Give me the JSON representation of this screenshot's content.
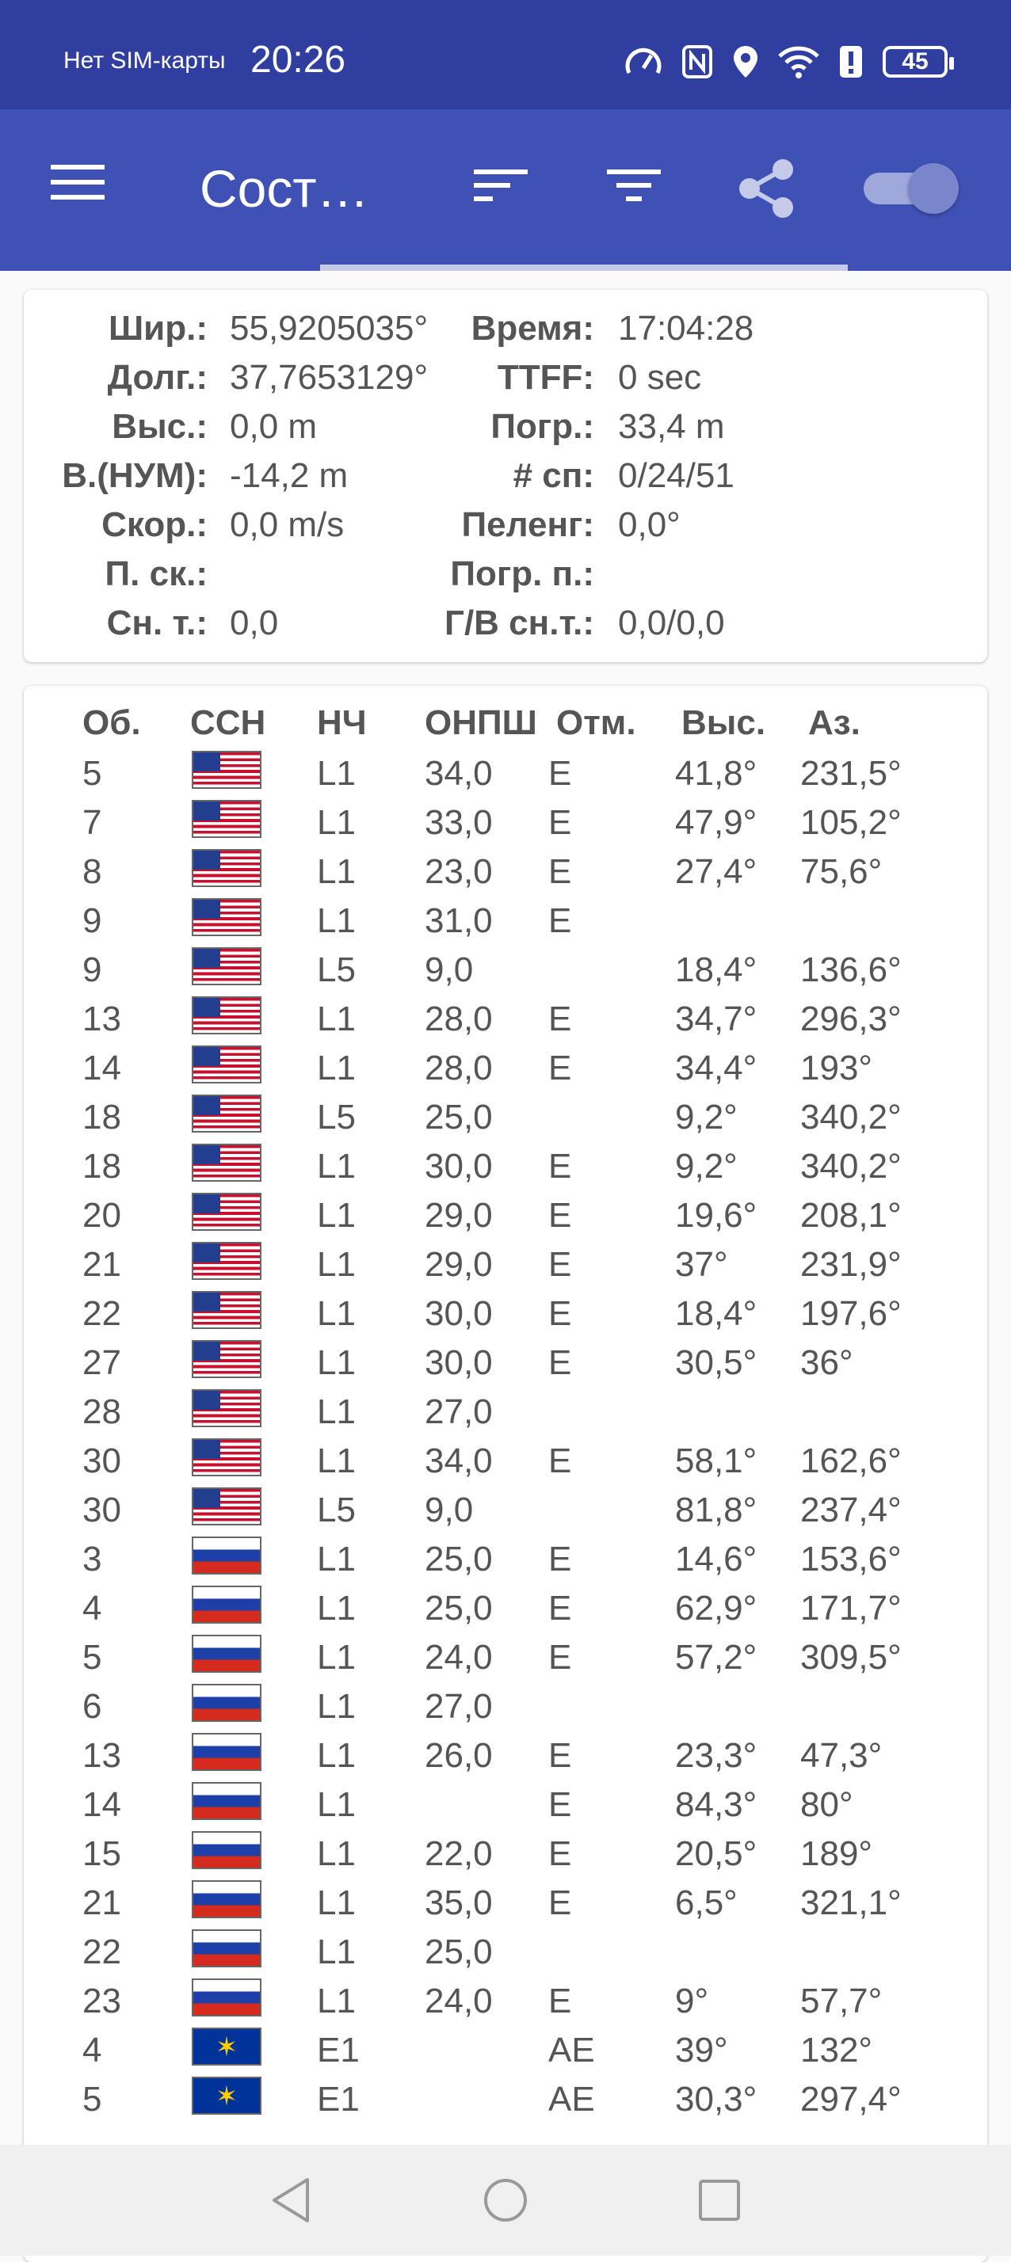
{
  "status_bar": {
    "carrier": "Нет SIM-карты",
    "time": "20:26",
    "battery": "45"
  },
  "app_bar": {
    "title": "Сост…",
    "colors": {
      "primary": "#3f51b5",
      "status": "#303f9f"
    }
  },
  "location": {
    "left": [
      {
        "label": "Шир.:",
        "value": "55,9205035°"
      },
      {
        "label": "Долг.:",
        "value": "37,7653129°"
      },
      {
        "label": "Выс.:",
        "value": "0,0 m"
      },
      {
        "label": "В.(НУМ):",
        "value": "-14,2 m"
      },
      {
        "label": "Скор.:",
        "value": "0,0 m/s"
      },
      {
        "label": "П. ск.:",
        "value": ""
      },
      {
        "label": "Сн. т.:",
        "value": "0,0"
      }
    ],
    "right": [
      {
        "label": "Время:",
        "value": "17:04:28"
      },
      {
        "label": "TTFF:",
        "value": "0 sec"
      },
      {
        "label": "Погр.:",
        "value": "33,4 m"
      },
      {
        "label": "# сп:",
        "value": "0/24/51"
      },
      {
        "label": "Пеленг:",
        "value": "0,0°"
      },
      {
        "label": "Погр. п.:",
        "value": ""
      },
      {
        "label": "Г/В сн.т.:",
        "value": "0,0/0,0"
      }
    ]
  },
  "satellites": {
    "headers": [
      "Об.",
      "ССН",
      "НЧ",
      "ОНПШ",
      "Отм.",
      "Выс.",
      "Аз."
    ],
    "rows": [
      {
        "id": "5",
        "flag": "us",
        "freq": "L1",
        "cn0": "34,0",
        "flags": "E",
        "elev": "41,8°",
        "azim": "231,5°"
      },
      {
        "id": "7",
        "flag": "us",
        "freq": "L1",
        "cn0": "33,0",
        "flags": "E",
        "elev": "47,9°",
        "azim": "105,2°"
      },
      {
        "id": "8",
        "flag": "us",
        "freq": "L1",
        "cn0": "23,0",
        "flags": "E",
        "elev": "27,4°",
        "azim": "75,6°"
      },
      {
        "id": "9",
        "flag": "us",
        "freq": "L1",
        "cn0": "31,0",
        "flags": "E",
        "elev": "",
        "azim": ""
      },
      {
        "id": "9",
        "flag": "us",
        "freq": "L5",
        "cn0": "9,0",
        "flags": "",
        "elev": "18,4°",
        "azim": "136,6°"
      },
      {
        "id": "13",
        "flag": "us",
        "freq": "L1",
        "cn0": "28,0",
        "flags": "E",
        "elev": "34,7°",
        "azim": "296,3°"
      },
      {
        "id": "14",
        "flag": "us",
        "freq": "L1",
        "cn0": "28,0",
        "flags": "E",
        "elev": "34,4°",
        "azim": "193°"
      },
      {
        "id": "18",
        "flag": "us",
        "freq": "L5",
        "cn0": "25,0",
        "flags": "",
        "elev": "9,2°",
        "azim": "340,2°"
      },
      {
        "id": "18",
        "flag": "us",
        "freq": "L1",
        "cn0": "30,0",
        "flags": "E",
        "elev": "9,2°",
        "azim": "340,2°"
      },
      {
        "id": "20",
        "flag": "us",
        "freq": "L1",
        "cn0": "29,0",
        "flags": "E",
        "elev": "19,6°",
        "azim": "208,1°"
      },
      {
        "id": "21",
        "flag": "us",
        "freq": "L1",
        "cn0": "29,0",
        "flags": "E",
        "elev": "37°",
        "azim": "231,9°"
      },
      {
        "id": "22",
        "flag": "us",
        "freq": "L1",
        "cn0": "30,0",
        "flags": "E",
        "elev": "18,4°",
        "azim": "197,6°"
      },
      {
        "id": "27",
        "flag": "us",
        "freq": "L1",
        "cn0": "30,0",
        "flags": "E",
        "elev": "30,5°",
        "azim": "36°"
      },
      {
        "id": "28",
        "flag": "us",
        "freq": "L1",
        "cn0": "27,0",
        "flags": "",
        "elev": "",
        "azim": ""
      },
      {
        "id": "30",
        "flag": "us",
        "freq": "L1",
        "cn0": "34,0",
        "flags": "E",
        "elev": "58,1°",
        "azim": "162,6°"
      },
      {
        "id": "30",
        "flag": "us",
        "freq": "L5",
        "cn0": "9,0",
        "flags": "",
        "elev": "81,8°",
        "azim": "237,4°"
      },
      {
        "id": "3",
        "flag": "ru",
        "freq": "L1",
        "cn0": "25,0",
        "flags": "E",
        "elev": "14,6°",
        "azim": "153,6°"
      },
      {
        "id": "4",
        "flag": "ru",
        "freq": "L1",
        "cn0": "25,0",
        "flags": "E",
        "elev": "62,9°",
        "azim": "171,7°"
      },
      {
        "id": "5",
        "flag": "ru",
        "freq": "L1",
        "cn0": "24,0",
        "flags": "E",
        "elev": "57,2°",
        "azim": "309,5°"
      },
      {
        "id": "6",
        "flag": "ru",
        "freq": "L1",
        "cn0": "27,0",
        "flags": "",
        "elev": "",
        "azim": ""
      },
      {
        "id": "13",
        "flag": "ru",
        "freq": "L1",
        "cn0": "26,0",
        "flags": "E",
        "elev": "23,3°",
        "azim": "47,3°"
      },
      {
        "id": "14",
        "flag": "ru",
        "freq": "L1",
        "cn0": "",
        "flags": "E",
        "elev": "84,3°",
        "azim": "80°"
      },
      {
        "id": "15",
        "flag": "ru",
        "freq": "L1",
        "cn0": "22,0",
        "flags": "E",
        "elev": "20,5°",
        "azim": "189°"
      },
      {
        "id": "21",
        "flag": "ru",
        "freq": "L1",
        "cn0": "35,0",
        "flags": "E",
        "elev": "6,5°",
        "azim": "321,1°"
      },
      {
        "id": "22",
        "flag": "ru",
        "freq": "L1",
        "cn0": "25,0",
        "flags": "",
        "elev": "",
        "azim": ""
      },
      {
        "id": "23",
        "flag": "ru",
        "freq": "L1",
        "cn0": "24,0",
        "flags": "E",
        "elev": "9°",
        "azim": "57,7°"
      },
      {
        "id": "4",
        "flag": "eu",
        "freq": "E1",
        "cn0": "",
        "flags": "AE",
        "elev": "39°",
        "azim": "132°"
      },
      {
        "id": "5",
        "flag": "eu",
        "freq": "E1",
        "cn0": "",
        "flags": "AE",
        "elev": "30,3°",
        "azim": "297,4°"
      }
    ]
  }
}
